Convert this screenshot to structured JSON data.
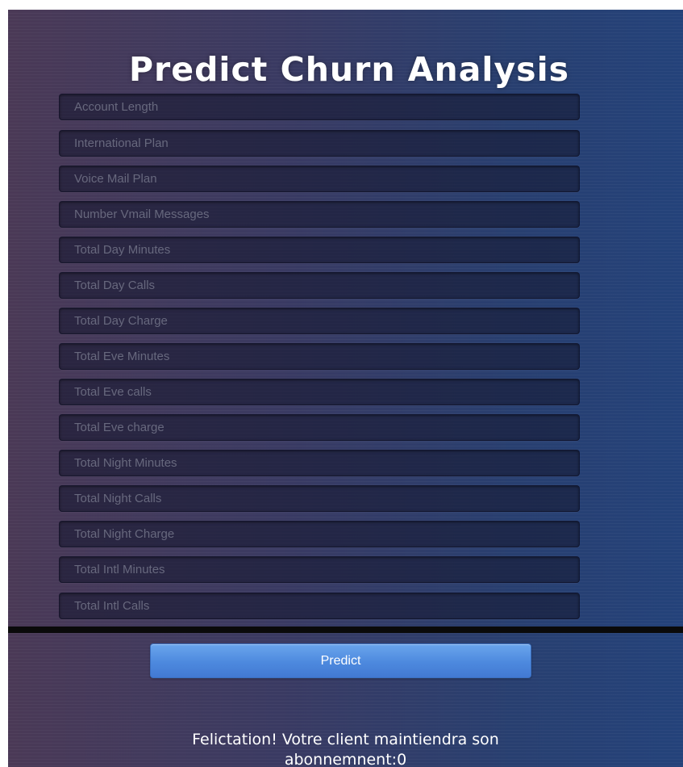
{
  "page": {
    "title": "Predict Churn Analysis"
  },
  "form": {
    "fields": [
      {
        "placeholder": "Account Length",
        "value": ""
      },
      {
        "placeholder": "International Plan",
        "value": ""
      },
      {
        "placeholder": "Voice Mail Plan",
        "value": ""
      },
      {
        "placeholder": "Number Vmail Messages",
        "value": ""
      },
      {
        "placeholder": "Total Day Minutes",
        "value": ""
      },
      {
        "placeholder": "Total Day Calls",
        "value": ""
      },
      {
        "placeholder": "Total Day Charge",
        "value": ""
      },
      {
        "placeholder": "Total Eve Minutes",
        "value": ""
      },
      {
        "placeholder": "Total Eve calls",
        "value": ""
      },
      {
        "placeholder": "Total Eve charge",
        "value": ""
      },
      {
        "placeholder": "Total Night Minutes",
        "value": ""
      },
      {
        "placeholder": "Total Night Calls",
        "value": ""
      },
      {
        "placeholder": "Total Night Charge",
        "value": ""
      },
      {
        "placeholder": "Total Intl Minutes",
        "value": ""
      },
      {
        "placeholder": "Total Intl Calls",
        "value": ""
      }
    ],
    "submit_label": "Predict"
  },
  "result": {
    "line1": "Felictation! Votre client maintiendra son",
    "line2": "abonnemnent:0"
  },
  "colors": {
    "background_left": "#4a3956",
    "background_right": "#24427a",
    "button": "#4d89de",
    "text": "#ffffff"
  }
}
